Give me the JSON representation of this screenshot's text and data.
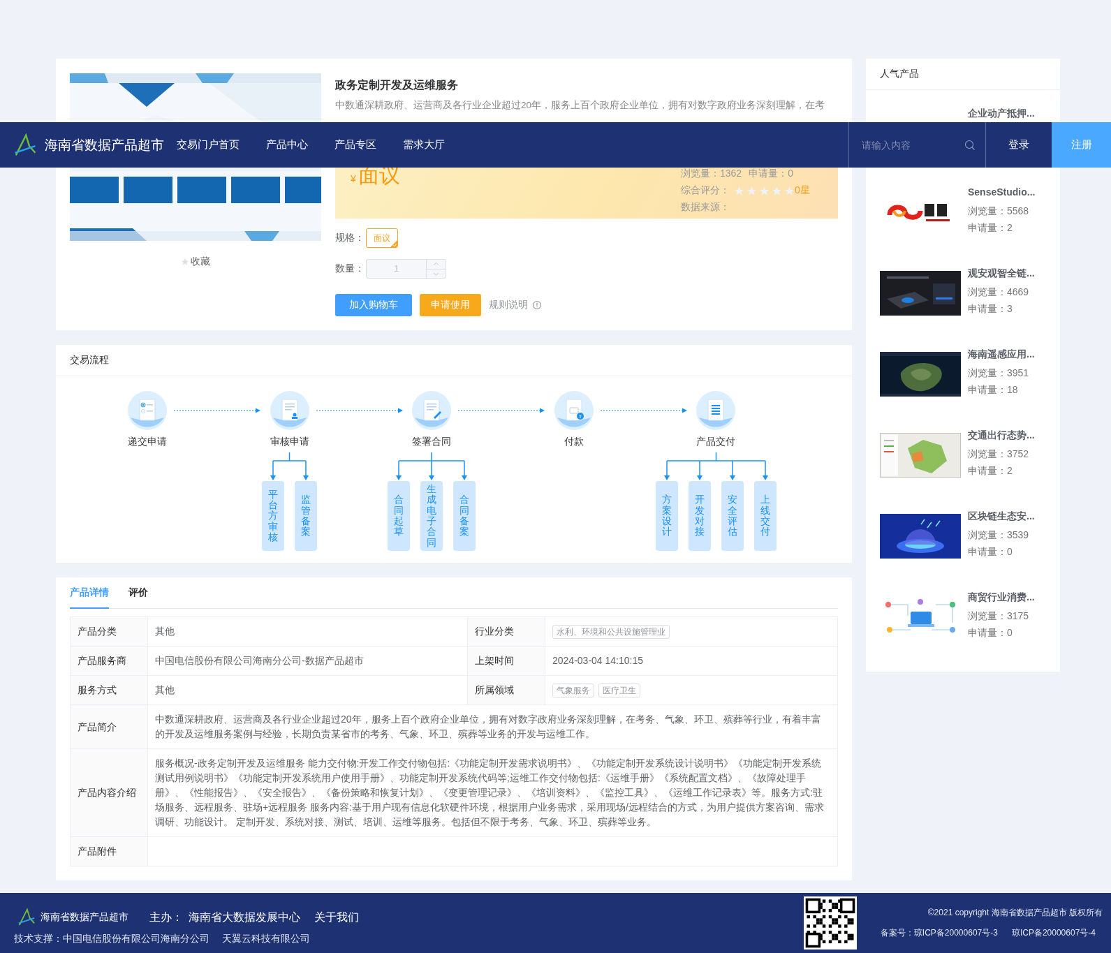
{
  "nav": {
    "title": "海南省数据产品超市",
    "items": [
      "交易门户首页",
      "产品中心",
      "产品专区",
      "需求大厅"
    ],
    "search": {
      "placeholder": "请输入内容"
    },
    "login": "登录",
    "register": "注册"
  },
  "product": {
    "favorite": "收藏",
    "favorited": false,
    "title": "政务定制开发及运维服务",
    "description": "中数通深耕政府、运营商及各行业企业超过20年，服务上百个政府企业单位，拥有对数字政府业务深刻理解，在考",
    "price_symbol": "¥",
    "price": "面议",
    "views": "浏览量：1362",
    "applies": "申请量：0",
    "rating_label": "综合评分：",
    "stars": 0,
    "rating_text": "0星",
    "source_label": "数据来源：",
    "spec_label": "规格：",
    "specs": [
      {
        "label": "面议",
        "selected": true
      }
    ],
    "quantity_label": "数量：",
    "quantity": "1",
    "quantity_disabled": true,
    "buttons": [
      {
        "label": "加入购物车",
        "kind": "primary"
      },
      {
        "label": "申请使用",
        "kind": "warning"
      }
    ],
    "rules_link": "规则说明"
  },
  "flow": {
    "title": "交易流程",
    "steps": [
      {
        "label": "递交申请"
      },
      {
        "label": "审核申请",
        "children": [
          "平台方审核",
          "监管备案"
        ]
      },
      {
        "label": "签署合同",
        "children": [
          "合同起草",
          "生成电子合同",
          "合同备案"
        ]
      },
      {
        "label": "付款"
      },
      {
        "label": "产品交付",
        "children": [
          "方案设计",
          "开发对接",
          "安全评估",
          "上线交付"
        ]
      }
    ]
  },
  "tabs": [
    {
      "label": "产品详情",
      "selected": true
    },
    {
      "label": "评价",
      "selected": false
    }
  ],
  "details": {
    "rows": [
      {
        "fields": [
          {
            "label": "产品分类",
            "value": "其他"
          },
          {
            "label": "行业分类",
            "tags": [
              "水利、环境和公共设施管理业"
            ]
          }
        ]
      },
      {
        "fields": [
          {
            "label": "产品服务商",
            "value": "中国电信股份有限公司海南分公司-数据产品超市"
          },
          {
            "label": "上架时间",
            "value": "2024-03-04 14:10:15"
          }
        ]
      },
      {
        "fields": [
          {
            "label": "服务方式",
            "value": "其他"
          },
          {
            "label": "所属领域",
            "tags": [
              "气象服务",
              "医疗卫生"
            ]
          }
        ]
      },
      {
        "fields": [
          {
            "label": "产品简介",
            "value": "中数通深耕政府、运营商及各行业企业超过20年，服务上百个政府企业单位，拥有对数字政府业务深刻理解，在考务、气象、环卫、殡葬等行业，有着丰富的开发及运维服务案例与经验，长期负责某省市的考务、气象、环卫、殡葬等业务的开发与运维工作。"
          }
        ]
      },
      {
        "fields": [
          {
            "label": "产品内容介绍",
            "value": "服务概况-政务定制开发及运维服务 能力交付物:开发工作交付物包括:《功能定制开发需求说明书》、《功能定制开发系统设计说明书》《功能定制开发系统测试用例说明书》《功能定制开发系统用户使用手册》、功能定制开发系统代码等;运维工作交付物包括:《运维手册》《系统配置文档》、《故障处理手册》、《性能报告》、《安全报告》、《备份策略和恢复计划》、《变更管理记录》、《培训资料》、《监控工具》、《运维工作记录表》等。服务方式:驻场服务、远程服务、驻场+远程服务 服务内容:基于用户现有信息化软硬件环境，根据用户业务需求，采用现场/远程结合的方式，为用户提供方案咨询、需求调研、功能设计。 定制开发、系统对接、测试、培训、运维等服务。包括但不限于考务、气象、环卫、殡葬等业务。"
          }
        ]
      },
      {
        "fields": [
          {
            "label": "产品附件"
          }
        ]
      }
    ]
  },
  "sidebar": {
    "title": "人气产品",
    "items": [
      {
        "title": "企业动产抵押...",
        "picture": false
      },
      {
        "title": "SenseStudio...",
        "views": "浏览量：5568",
        "applies": "申请量：2",
        "picture": true
      },
      {
        "title": "观安观智全链...",
        "views": "浏览量：4669",
        "applies": "申请量：3",
        "picture": true
      },
      {
        "title": "海南遥感应用...",
        "views": "浏览量：3951",
        "applies": "申请量：18",
        "picture": true
      },
      {
        "title": "交通出行态势...",
        "views": "浏览量：3752",
        "applies": "申请量：2",
        "picture": true
      },
      {
        "title": "区块链生态安...",
        "views": "浏览量：3539",
        "applies": "申请量：0",
        "picture": true
      },
      {
        "title": "商贸行业消费...",
        "views": "浏览量：3175",
        "applies": "申请量：0",
        "picture": true
      }
    ]
  },
  "footer": {
    "site": "海南省数据产品超市",
    "host_label": "主办：",
    "host": "海南省大数据发展中心",
    "about": "关于我们",
    "support_label": "技术支撑：中国电信股份有限公司海南分公司",
    "support_2": "天翼云科技有限公司",
    "copyright": "©2021 copyright 海南省数据产品超市 版权所有",
    "icp_1": "备案号：琼ICP备20000607号-3",
    "icp_2": "琼ICP备20000607号-4"
  }
}
